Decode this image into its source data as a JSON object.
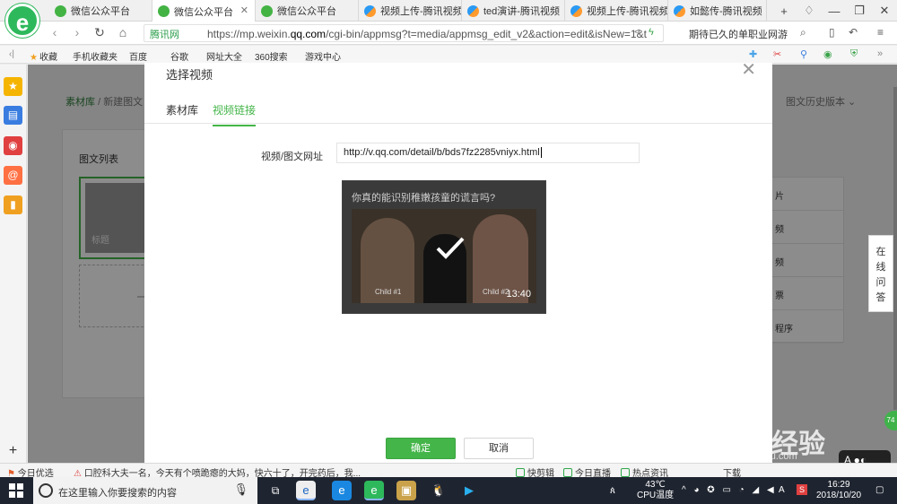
{
  "browser": {
    "logo": "e",
    "tabs": [
      {
        "label": "微信公众平台",
        "icon": "wechat",
        "active": false
      },
      {
        "label": "微信公众平台",
        "icon": "wechat",
        "active": true
      },
      {
        "label": "微信公众平台",
        "icon": "wechat",
        "active": false
      },
      {
        "label": "视频上传-腾讯视频",
        "icon": "tencent-video",
        "active": false
      },
      {
        "label": "ted演讲-腾讯视频",
        "icon": "tencent-video",
        "active": false
      },
      {
        "label": "视频上传-腾讯视频",
        "icon": "tencent-video",
        "active": false
      },
      {
        "label": "如懿传-腾讯视频",
        "icon": "tencent-video",
        "active": false
      }
    ],
    "new_tab": "+",
    "address": {
      "security_label": "腾讯网",
      "url_prefix": "https://mp.weixin.",
      "url_domain": "qq.com",
      "url_suffix": "/cgi-bin/appmsg?t=media/appmsg_edit_v2&action=edit&isNew=1&t"
    },
    "search_text": "期待已久的单职业网游"
  },
  "bookmarks": [
    {
      "label": "收藏"
    },
    {
      "label": "手机收藏夹"
    },
    {
      "label": "百度"
    },
    {
      "label": "谷歌"
    },
    {
      "label": "网址大全"
    },
    {
      "label": "360搜索"
    },
    {
      "label": "游戏中心"
    }
  ],
  "page": {
    "breadcrumb_root": "素材库",
    "breadcrumb_sep": "/",
    "breadcrumb_current": "新建图文",
    "history": "图文历史版本",
    "list_title": "图文列表",
    "item_title": "标题",
    "add_symbol": "—",
    "right_items": [
      "片",
      "频",
      "频",
      "票",
      "程序"
    ]
  },
  "dialog": {
    "title": "选择视频",
    "close": "✕",
    "tabs": [
      {
        "label": "素材库",
        "active": false
      },
      {
        "label": "视频链接",
        "active": true
      }
    ],
    "field_label": "视频/图文网址",
    "url_value": "http://v.qq.com/detail/b/bds7fz2285vniyx.html",
    "preview": {
      "title": "你真的能识别稚嫩孩童的谎言吗?",
      "caption_left": "Child #1",
      "caption_right": "Child #2",
      "duration": "13:40",
      "selected": true
    },
    "confirm": "确定",
    "cancel": "取消"
  },
  "help": {
    "chars": [
      "在",
      "线",
      "问",
      "答"
    ]
  },
  "watermark": {
    "text": "Bai du 经验",
    "sub": "jingyan.baidu.com"
  },
  "statusbar": {
    "left": "今日优选",
    "news": "口腔科大夫一名，今天有个喷跪瘪的大妈，快六十了，开完药后，我...",
    "items": [
      "快剪辑",
      "今日直播",
      "热点资讯",
      "下载"
    ]
  },
  "taskbar": {
    "search_placeholder": "在这里输入你要搜索的内容",
    "weather_temp": "43℃",
    "weather_label": "CPU温度",
    "ime": "A",
    "time": "16:29",
    "date": "2018/10/20"
  },
  "colors": {
    "accent": "#44b549",
    "logo": "#2eb85c",
    "taskbar": "#1f2530"
  }
}
